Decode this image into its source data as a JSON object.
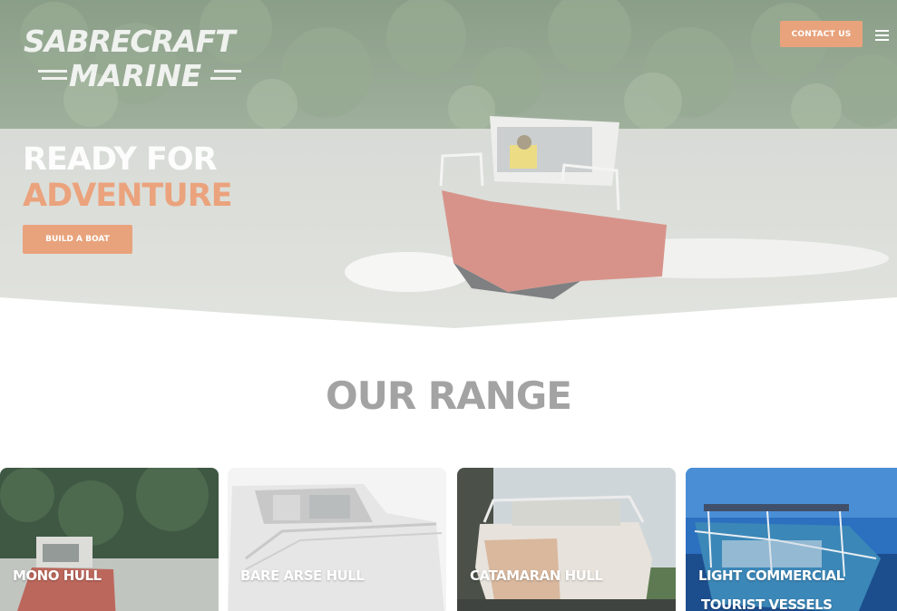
{
  "brand": {
    "logo_line1": "SABRECRAFT",
    "logo_line2": "MARINE"
  },
  "header": {
    "contact_label": "CONTACT US",
    "menu_icon": "hamburger-menu-icon"
  },
  "hero": {
    "title_line1": "READY FOR",
    "title_line2": "ADVENTURE",
    "cta_label": "BUILD A BOAT"
  },
  "range": {
    "title": "OUR RANGE",
    "cards": [
      {
        "label": "MONO HULL"
      },
      {
        "label": "BARE ARSE HULL"
      },
      {
        "label": "CATAMARAN HULL"
      },
      {
        "label_line1": "LIGHT COMMERCIAL",
        "label_line2": "TOURIST VESSELS"
      }
    ]
  },
  "colors": {
    "accent": "#e8a37c",
    "heading_gray": "#a3a3a3",
    "white": "#ffffff"
  }
}
